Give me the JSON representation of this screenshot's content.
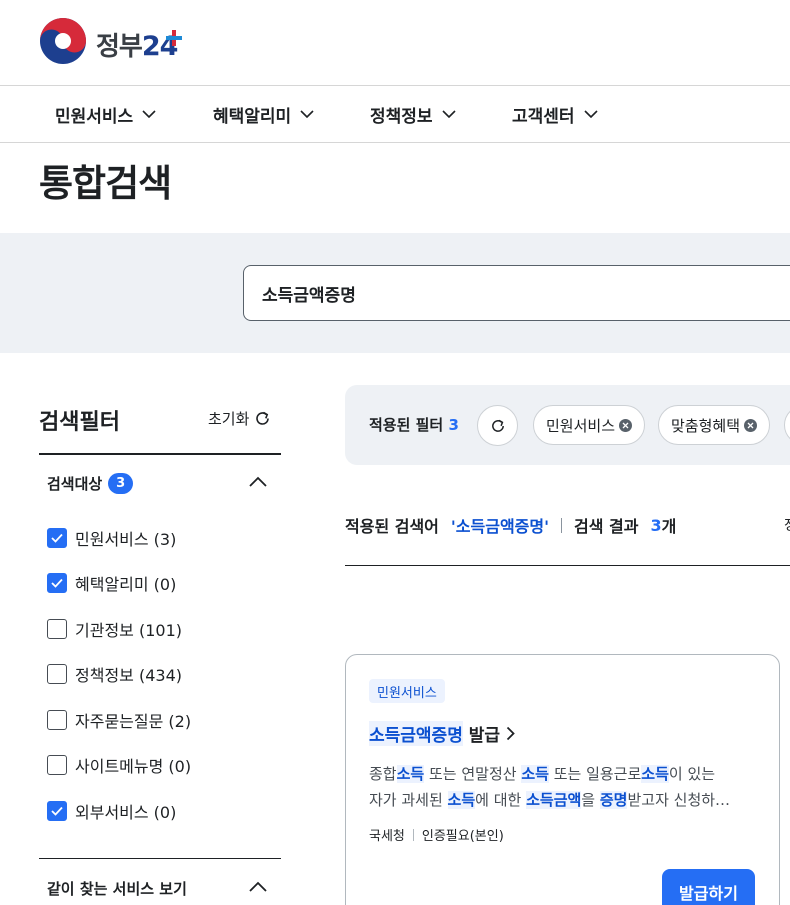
{
  "brand": {
    "logo_text": "정부",
    "logo_num": "24"
  },
  "gnb": [
    {
      "label": "민원서비스"
    },
    {
      "label": "혜택알리미"
    },
    {
      "label": "정책정보"
    },
    {
      "label": "고객센터"
    }
  ],
  "page_title": "통합검색",
  "search": {
    "value": "소득금액증명"
  },
  "sidebar": {
    "title": "검색필터",
    "reset_label": "초기화",
    "group1": {
      "label": "검색대상",
      "badge": "3"
    },
    "checks": [
      {
        "label": "민원서비스 (3)",
        "checked": true
      },
      {
        "label": "혜택알리미 (0)",
        "checked": true
      },
      {
        "label": "기관정보 (101)",
        "checked": false
      },
      {
        "label": "정책정보 (434)",
        "checked": false
      },
      {
        "label": "자주묻는질문 (2)",
        "checked": false
      },
      {
        "label": "사이트메뉴명 (0)",
        "checked": false
      },
      {
        "label": "외부서비스 (0)",
        "checked": true
      }
    ],
    "group2": {
      "label": "같이 찾는 서비스 보기"
    }
  },
  "filters": {
    "label": "적용된 필터",
    "count": "3",
    "chips": [
      {
        "label": "민원서비스"
      },
      {
        "label": "맞춤형혜택"
      }
    ]
  },
  "result": {
    "applied_label": "적용된 검색어",
    "keyword": "'소득금액증명'",
    "count_label": "검색 결과",
    "count": "3",
    "count_unit": "개",
    "cut_text": "정"
  },
  "card": {
    "tag": "민원서비스",
    "title_hl": "소득금액증명",
    "title_rest": "발급",
    "desc1": [
      "종합",
      "소득",
      " 또는 연말정산 ",
      "소득",
      " 또는 일용근로",
      "소득",
      "이 있는"
    ],
    "desc2": [
      "자가 과세된 ",
      "소득",
      "에 대한 ",
      "소득금액",
      "을 ",
      "증명",
      "받고자 신청하…"
    ],
    "org": "국세청",
    "auth": "인증필요(본인)",
    "button": "발급하기"
  },
  "colors": {
    "primary": "#256ef4",
    "highlight_bg": "#ecf2fe",
    "highlight_text": "#0b50d0",
    "band": "#eef1f5"
  }
}
